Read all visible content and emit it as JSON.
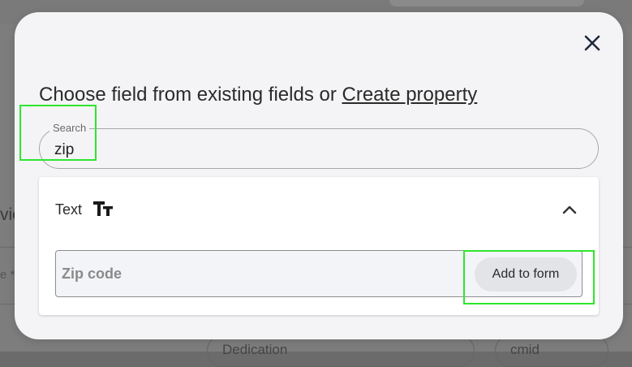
{
  "background": {
    "partial_heading": "vie",
    "partial_label": "e *",
    "pills": [
      "Dedication",
      "cmid"
    ]
  },
  "modal": {
    "title_prefix": "Choose field from existing fields or ",
    "title_link": "Create property",
    "close_icon": "close-icon",
    "search": {
      "label": "Search",
      "value": "zip"
    },
    "results": {
      "group_label": "Text",
      "group_icon": "text-type-icon",
      "collapse_icon": "chevron-up-icon",
      "items": [
        {
          "name": "Zip code",
          "action": "Add to form"
        }
      ]
    }
  },
  "colors": {
    "highlight": "#2ee62e",
    "modal_bg": "#f4f4f6"
  }
}
